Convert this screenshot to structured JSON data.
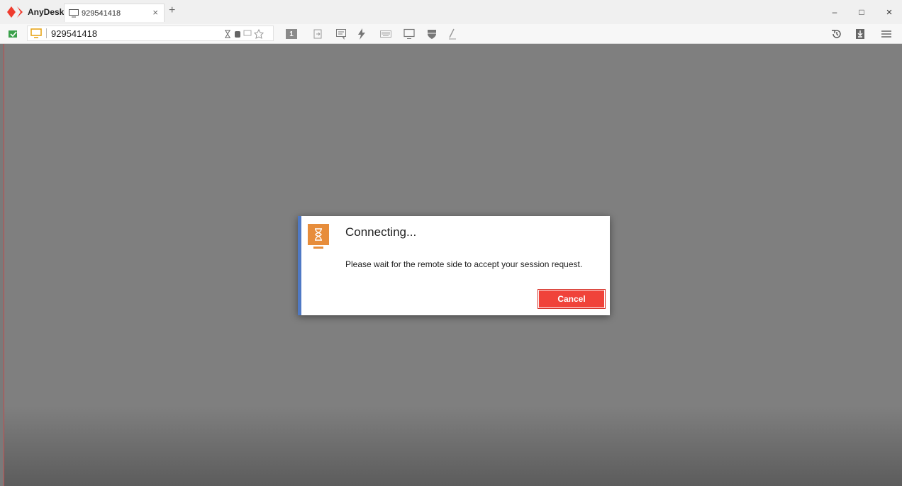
{
  "app": {
    "name": "AnyDesk"
  },
  "tab": {
    "label": "929541418",
    "close": "×"
  },
  "new_tab": "+",
  "window_controls": {
    "minimize": "–",
    "maximize": "□",
    "close": "×"
  },
  "address": {
    "value": "929541418"
  },
  "toolbar_icons": [
    "hourglass-icon",
    "database-icon",
    "monitor-chat-icon",
    "star-icon",
    "display-1-icon",
    "file-transfer-icon",
    "chat-icon",
    "lightning-icon",
    "keyboard-icon",
    "monitor-icon",
    "shield-icon",
    "pen-icon"
  ],
  "right_icons": [
    "history-icon",
    "download-icon",
    "menu-icon"
  ],
  "page1_label": "1",
  "dialog": {
    "title": "Connecting...",
    "message": "Please wait for the remote side to accept your session request.",
    "cancel_label": "Cancel"
  },
  "colors": {
    "accent_red": "#f0433a",
    "dialog_icon": "#e78d3b",
    "dialog_border": "#4f79c5",
    "remote_bg": "#7f7f7f"
  }
}
